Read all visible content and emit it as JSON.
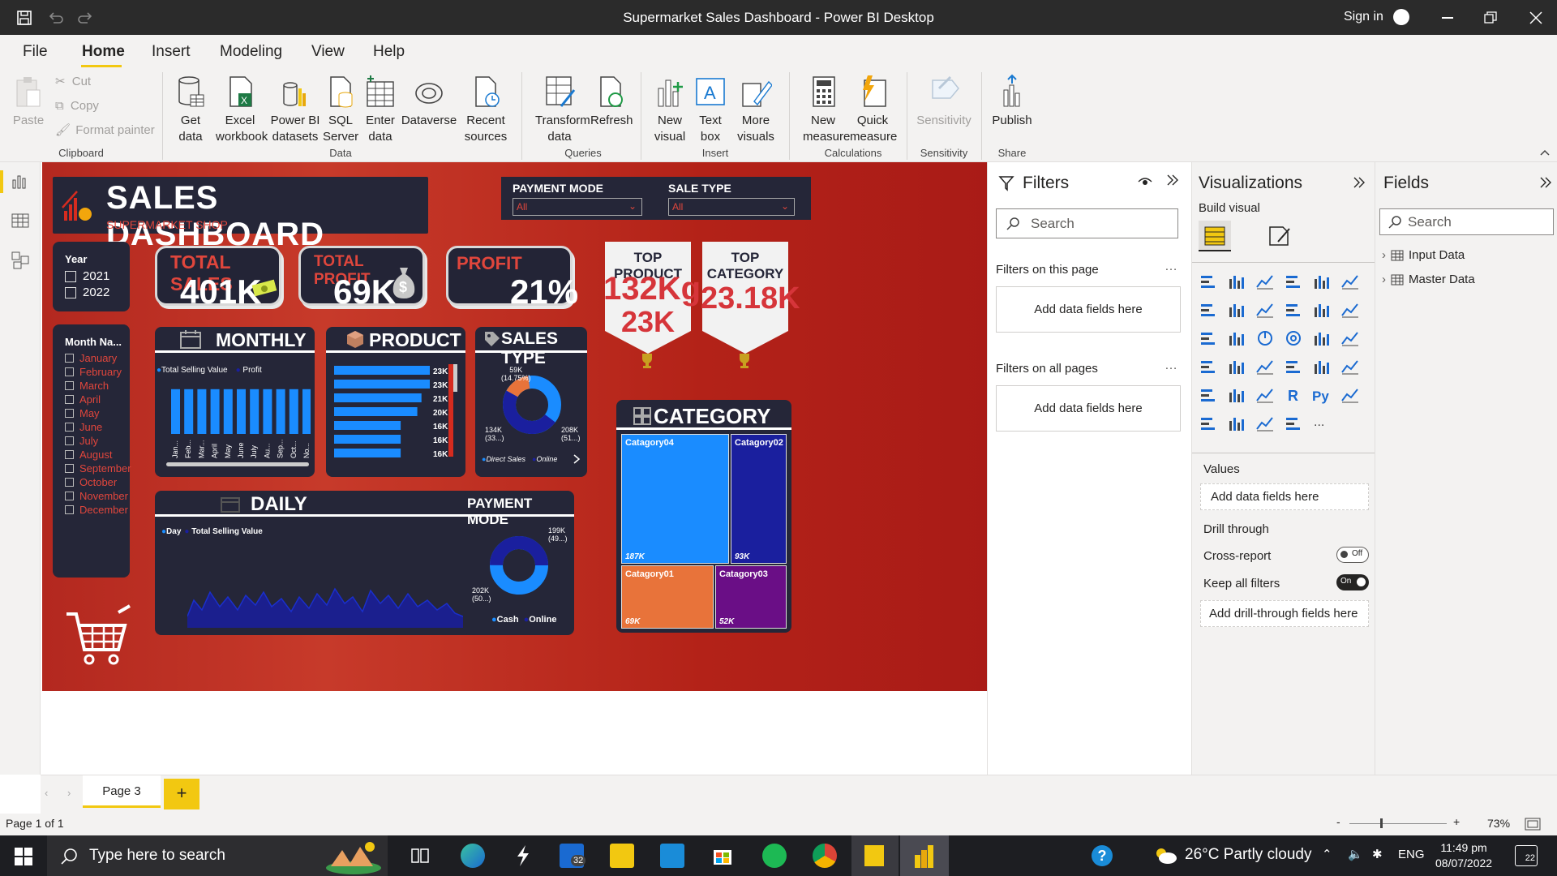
{
  "window": {
    "title": "Supermarket Sales Dashboard - Power BI Desktop",
    "sign_in": "Sign in"
  },
  "menu": [
    "File",
    "Home",
    "Insert",
    "Modeling",
    "View",
    "Help"
  ],
  "ribbon": {
    "clipboard": {
      "paste": "Paste",
      "cut": "Cut",
      "copy": "Copy",
      "format_painter": "Format painter",
      "group": "Clipboard"
    },
    "data": {
      "get_data": "Get data",
      "excel": "Excel workbook",
      "pbi": "Power BI datasets",
      "sql": "SQL Server",
      "enter": "Enter data",
      "dataverse": "Dataverse",
      "recent": "Recent sources",
      "group": "Data"
    },
    "queries": {
      "transform": "Transform data",
      "refresh": "Refresh",
      "group": "Queries"
    },
    "insert": {
      "new_visual": "New visual",
      "text_box": "Text box",
      "more": "More visuals",
      "group": "Insert"
    },
    "calc": {
      "new_measure": "New measure",
      "quick": "Quick measure",
      "group": "Calculations"
    },
    "sens": {
      "sensitivity": "Sensitivity",
      "group": "Sensitivity"
    },
    "share": {
      "publish": "Publish",
      "group": "Share"
    }
  },
  "report": {
    "title": "SALES DASHBOARD",
    "subtitle": "SUPERMARKET SHOP",
    "payment_slicer": {
      "label": "PAYMENT MODE",
      "value": "All"
    },
    "sale_slicer": {
      "label": "SALE TYPE",
      "value": "All"
    },
    "year": {
      "label": "Year",
      "items": [
        "2021",
        "2022"
      ]
    },
    "months": {
      "label": "Month Na...",
      "items": [
        "January",
        "February",
        "March",
        "April",
        "May",
        "June",
        "July",
        "August",
        "September",
        "October",
        "November",
        "December"
      ]
    },
    "kpis": {
      "sales_label": "TOTAL SALES",
      "sales_value": "401K",
      "profit_label": "TOTAL PROFIT",
      "profit_value": "69K",
      "pct_label": "PROFIT",
      "pct_value": "21%"
    },
    "top_product": {
      "label": "TOP PRODUCT",
      "value1": "132Kg",
      "value2": "23K"
    },
    "top_category": {
      "label": "TOP CATEGORY",
      "value": "23.18K"
    },
    "monthly": {
      "title": "MONTHLY",
      "legend": [
        "Total Selling Value",
        "Profit"
      ],
      "months": [
        "Jan...",
        "Feb...",
        "Mar...",
        "April",
        "May",
        "June",
        "July",
        "Au...",
        "Sep...",
        "Oct...",
        "No..."
      ],
      "values": [
        0.92,
        0.92,
        0.92,
        0.92,
        0.92,
        0.92,
        0.92,
        0.92,
        0.92,
        0.92,
        0.92
      ]
    },
    "product": {
      "title": "PRODUCT",
      "labels": [
        "23K",
        "23K",
        "21K",
        "20K",
        "16K",
        "16K",
        "16K"
      ],
      "values": [
        23,
        23,
        21,
        20,
        16,
        16,
        16
      ]
    },
    "sales_type": {
      "title": "SALES TYPE",
      "top": "59K",
      "top2": "(14.75%)",
      "left": "134K",
      "left2": "(33...)",
      "right": "208K",
      "right2": "(51...)",
      "legend": [
        "Direct Sales",
        "Online"
      ]
    },
    "category": {
      "title": "CATEGORY",
      "cells": [
        {
          "name": "Catagory04",
          "value": "187K",
          "color": "#1a8cff"
        },
        {
          "name": "Catagory02",
          "value": "93K",
          "color": "#1a1f9e"
        },
        {
          "name": "Catagory01",
          "value": "69K",
          "color": "#e8733a"
        },
        {
          "name": "Catagory03",
          "value": "52K",
          "color": "#6a0e86"
        }
      ]
    },
    "daily": {
      "title": "DAILY",
      "legend": [
        "Day",
        "Total Selling Value"
      ]
    },
    "payment": {
      "title": "PAYMENT MODE",
      "right": "199K",
      "right2": "(49...)",
      "left": "202K",
      "left2": "(50...)",
      "legend": [
        "Cash",
        "Online"
      ]
    }
  },
  "filters": {
    "title": "Filters",
    "search": "Search",
    "on_page": "Filters on this page",
    "all_pages": "Filters on all pages",
    "add": "Add data fields here"
  },
  "viz": {
    "title": "Visualizations",
    "build": "Build visual",
    "values": "Values",
    "add": "Add data fields here",
    "drill": "Drill through",
    "cross": "Cross-report",
    "cross_state": "Off",
    "keep": "Keep all filters",
    "keep_state": "On",
    "add_drill": "Add drill-through fields here"
  },
  "fields": {
    "title": "Fields",
    "search": "Search",
    "tables": [
      "Input Data",
      "Master Data"
    ]
  },
  "pages": {
    "tab": "Page 3",
    "add": "+"
  },
  "status": {
    "page": "Page 1 of 1",
    "zoom": "73%"
  },
  "taskbar": {
    "search": "Type here to search",
    "mail_badge": "32",
    "weather": "26°C  Partly cloudy",
    "lang": "ENG",
    "time": "11:49 pm",
    "date": "08/07/2022",
    "notif": "22"
  }
}
